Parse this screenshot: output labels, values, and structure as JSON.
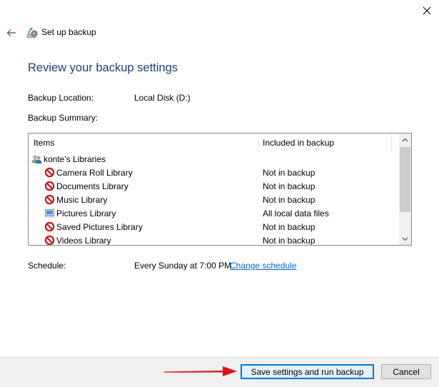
{
  "window": {
    "close_icon": "close-icon",
    "back_icon": "back-arrow-icon"
  },
  "header": {
    "app_title": "Set up backup",
    "app_icon": "backup-icon"
  },
  "main": {
    "page_title": "Review your backup settings",
    "backup_location_label": "Backup Location:",
    "backup_location_value": "Local Disk (D:)",
    "backup_summary_label": "Backup Summary:",
    "summary_table": {
      "columns": [
        "Items",
        "Included in backup"
      ],
      "rows": [
        {
          "name": "konte's Libraries",
          "status": "",
          "icon": "users-icon",
          "indent": 0
        },
        {
          "name": "Camera Roll Library",
          "status": "Not in backup",
          "icon": "blocked-icon",
          "indent": 1
        },
        {
          "name": "Documents Library",
          "status": "Not in backup",
          "icon": "blocked-icon",
          "indent": 1
        },
        {
          "name": "Music Library",
          "status": "Not in backup",
          "icon": "blocked-icon",
          "indent": 1
        },
        {
          "name": "Pictures Library",
          "status": "All local data files",
          "icon": "computer-icon",
          "indent": 1
        },
        {
          "name": "Saved Pictures Library",
          "status": "Not in backup",
          "icon": "blocked-icon",
          "indent": 1
        },
        {
          "name": "Videos Library",
          "status": "Not in backup",
          "icon": "blocked-icon",
          "indent": 1
        }
      ]
    },
    "schedule_label": "Schedule:",
    "schedule_value": "Every Sunday at 7:00 PM",
    "change_schedule_link": "Change schedule"
  },
  "footer": {
    "save_button": "Save settings and run backup",
    "cancel_button": "Cancel",
    "annotation_arrow_color": "#d9141c"
  },
  "colors": {
    "title_blue": "#1e3f78",
    "link_blue": "#0066cc",
    "focus_border": "#0078d7",
    "blocked_red": "#c4161c"
  }
}
